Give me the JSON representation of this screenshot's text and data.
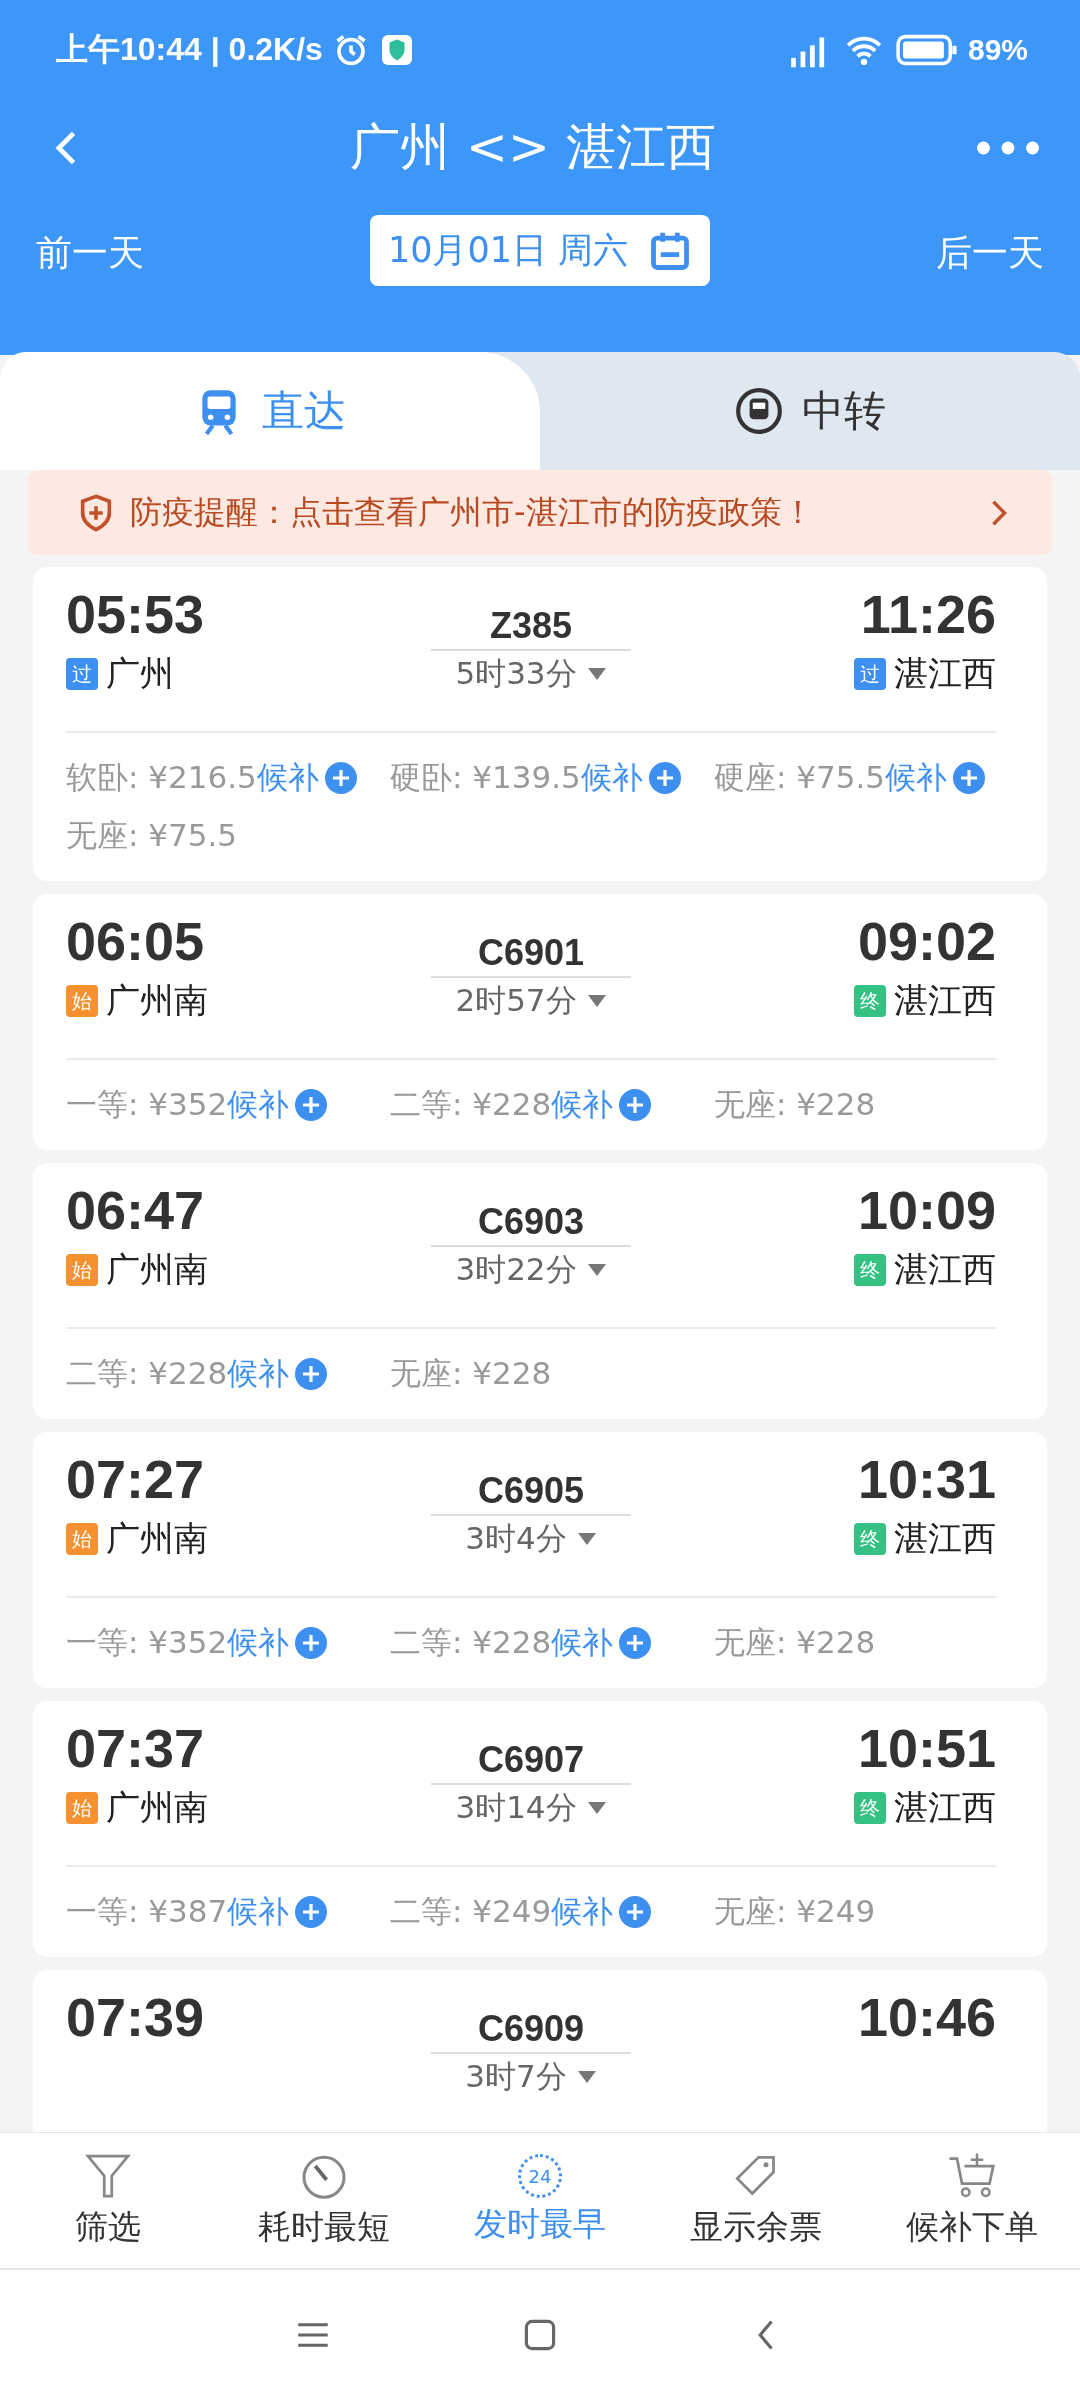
{
  "status_bar": {
    "time": "上午10:44 | 0.2K/s",
    "battery": "89%"
  },
  "header": {
    "title": "广州 <> 湛江西",
    "prev": "前一天",
    "date": "10月01日 周六",
    "next": "后一天"
  },
  "tabs": [
    {
      "label": "直达",
      "selected": true,
      "kind": "direct"
    },
    {
      "label": "中转",
      "selected": false,
      "kind": "transfer"
    }
  ],
  "notice": "防疫提醒：点击查看广州市-湛江市的防疫政策！",
  "trains": [
    {
      "depart": "05:53",
      "from_badge": {
        "text": "过",
        "color": "#3d8ff0"
      },
      "from": "广州",
      "number": "Z385",
      "duration": "5时33分",
      "arrive": "11:26",
      "to_badge": {
        "text": "过",
        "color": "#3d8ff0"
      },
      "to": "湛江西",
      "seats": [
        {
          "price": "软卧: ¥216.5",
          "waitlist": "候补"
        },
        {
          "price": "硬卧: ¥139.5",
          "waitlist": "候补"
        },
        {
          "price": "硬座: ¥75.5",
          "waitlist": "候补"
        },
        {
          "price": "无座: ¥75.5"
        }
      ]
    },
    {
      "depart": "06:05",
      "from_badge": {
        "text": "始",
        "color": "#f5922f"
      },
      "from": "广州南",
      "number": "C6901",
      "duration": "2时57分",
      "arrive": "09:02",
      "to_badge": {
        "text": "终",
        "color": "#35c181"
      },
      "to": "湛江西",
      "seats": [
        {
          "price": "一等: ¥352",
          "waitlist": "候补"
        },
        {
          "price": "二等: ¥228",
          "waitlist": "候补"
        },
        {
          "price": "无座: ¥228"
        }
      ]
    },
    {
      "depart": "06:47",
      "from_badge": {
        "text": "始",
        "color": "#f5922f"
      },
      "from": "广州南",
      "number": "C6903",
      "duration": "3时22分",
      "arrive": "10:09",
      "to_badge": {
        "text": "终",
        "color": "#35c181"
      },
      "to": "湛江西",
      "seats": [
        {
          "price": "二等: ¥228",
          "waitlist": "候补"
        },
        {
          "price": "无座: ¥228"
        }
      ]
    },
    {
      "depart": "07:27",
      "from_badge": {
        "text": "始",
        "color": "#f5922f"
      },
      "from": "广州南",
      "number": "C6905",
      "duration": "3时4分",
      "arrive": "10:31",
      "to_badge": {
        "text": "终",
        "color": "#35c181"
      },
      "to": "湛江西",
      "seats": [
        {
          "price": "一等: ¥352",
          "waitlist": "候补"
        },
        {
          "price": "二等: ¥228",
          "waitlist": "候补"
        },
        {
          "price": "无座: ¥228"
        }
      ]
    },
    {
      "depart": "07:37",
      "from_badge": {
        "text": "始",
        "color": "#f5922f"
      },
      "from": "广州南",
      "number": "C6907",
      "duration": "3时14分",
      "arrive": "10:51",
      "to_badge": {
        "text": "终",
        "color": "#35c181"
      },
      "to": "湛江西",
      "seats": [
        {
          "price": "一等: ¥387",
          "waitlist": "候补"
        },
        {
          "price": "二等: ¥249",
          "waitlist": "候补"
        },
        {
          "price": "无座: ¥249"
        }
      ]
    },
    {
      "depart": "07:39",
      "number": "C6909",
      "duration": "3时7分",
      "arrive": "10:46"
    }
  ],
  "bottom_bar": [
    {
      "label": "筛选",
      "kind": "filter",
      "selected": false
    },
    {
      "label": "耗时最短",
      "kind": "timer",
      "selected": false
    },
    {
      "label": "发时最早",
      "kind": "clock24",
      "icon_text": "24",
      "selected": true
    },
    {
      "label": "显示余票",
      "kind": "tag",
      "selected": false
    },
    {
      "label": "候补下单",
      "kind": "cart",
      "selected": false
    }
  ]
}
